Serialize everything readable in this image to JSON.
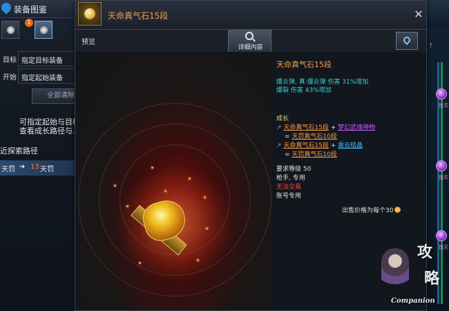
{
  "back_window": {
    "title": "装备图鉴",
    "tab_badge": "1",
    "target_label": "目标",
    "target_value": "指定目标装备",
    "start_label": "开始",
    "start_value": "指定起始装备",
    "clear_all": "全部清除",
    "hint_lines": [
      "可指定起始与目标",
      "查看成长路径与..."
    ],
    "recent_path": "近探索路径",
    "route": {
      "from": "天罚",
      "to_number": "13",
      "to": "天罚"
    }
  },
  "side_strip": {
    "orb_label": "蚀灭",
    "marker": "?"
  },
  "dialog": {
    "title": "天命真气石15段",
    "close": "✕",
    "preview_label": "预览",
    "detail_button": "详细内容",
    "info": {
      "item_name": "天命真气石15段",
      "stats": [
        "爆炎弹, 真·爆炎弹 伤害 31%增加",
        "爆裂 伤害 43%增加"
      ],
      "growth_title": "成长",
      "growth": [
        {
          "item": "天命真气石15段",
          "plus": "+",
          "material": "梦幻武魂神物",
          "result": "天罚真气石10段"
        },
        {
          "item": "天命真气石15段",
          "plus": "+",
          "material": "雷云结晶",
          "result": "天罚真气石10段"
        }
      ],
      "eq_sign": "=",
      "req_level": "要求等级 50",
      "class_only": "枪手, 专用",
      "no_trade": "无法交易",
      "account_only": "账号专用",
      "sell_price": "出售价格为每个30"
    }
  },
  "watermark": {
    "chars": [
      "攻",
      "略"
    ],
    "brand": "Companion"
  }
}
